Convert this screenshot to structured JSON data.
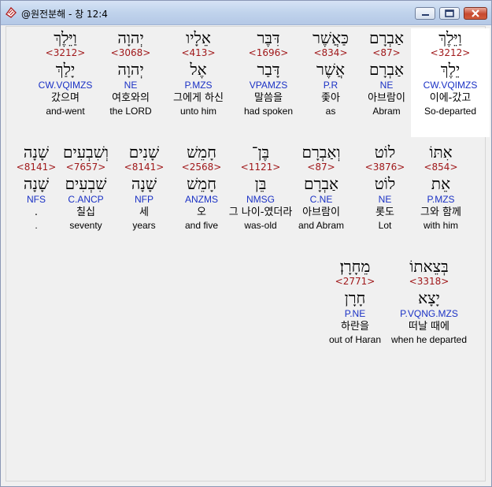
{
  "window": {
    "title": "@원전분해 - 창 12:4",
    "icon": "bible-icon",
    "controls": [
      "minimize-icon",
      "maximize-icon",
      "close-icon"
    ]
  },
  "rows": [
    {
      "words": [
        {
          "lex": "וַיֵּלֶךְ",
          "strong": "<3212>",
          "root": "יֵלֶךְ",
          "parse": "CW.VQIMZS",
          "kor": "이에-갔고",
          "eng": "So-departed",
          "highlight": true
        },
        {
          "lex": "אַבְרָם",
          "strong": "<87>",
          "root": "אַבְרָם",
          "parse": "NE",
          "kor": "아브람이",
          "eng": "Abram"
        },
        {
          "lex": "כַּאֲשֶׁר",
          "strong": "<834>",
          "root": "אֲשֶׁר",
          "parse": "P.R",
          "kor": "좇아",
          "eng": "as"
        },
        {
          "lex": "דִּבֶּר",
          "strong": "<1696>",
          "root": "דָּבַר",
          "parse": "VPAMZS",
          "kor": "말씀을",
          "eng": "had spoken"
        },
        {
          "lex": "אֵלָיו",
          "strong": "<413>",
          "root": "אֶל",
          "parse": "P.MZS",
          "kor": "그에게 하신",
          "eng": "unto him"
        },
        {
          "lex": "יְהוָה",
          "strong": "<3068>",
          "root": "יְהוָה",
          "parse": "NE",
          "kor": "여호와의",
          "eng": "the LORD"
        },
        {
          "lex": "וַיֵּלֶךְ",
          "strong": "<3212>",
          "root": "יָלַךְ",
          "parse": "CW.VQIMZS",
          "kor": "갔으며",
          "eng": "and-went"
        }
      ]
    },
    {
      "words": [
        {
          "lex": "אִתּוֹ",
          "strong": "<854>",
          "root": "אֵת",
          "parse": "P.MZS",
          "kor": "그와 함께",
          "eng": "with him"
        },
        {
          "lex": "לוֹט",
          "strong": "<3876>",
          "root": "לוֹט",
          "parse": "NE",
          "kor": "롯도",
          "eng": "Lot"
        },
        {
          "lex": "וְאַבְרָם",
          "strong": "<87>",
          "root": "אַבְרָם",
          "parse": "C.NE",
          "kor": "아브람이",
          "eng": "and Abram"
        },
        {
          "lex": "בֶּן־",
          "strong": "<1121>",
          "root": "בֵּן",
          "parse": "NMSG",
          "kor": "그 나이-였더라",
          "eng": "was-old"
        },
        {
          "lex": "חָמֵשׁ",
          "strong": "<2568>",
          "root": "חָמֵשׁ",
          "parse": "ANZMS",
          "kor": "오",
          "eng": "and five"
        },
        {
          "lex": "שָׁנִים",
          "strong": "<8141>",
          "root": "שָׁנָה",
          "parse": "NFP",
          "kor": "세",
          "eng": "years"
        },
        {
          "lex": "וְשִׁבְעִים",
          "strong": "<7657>",
          "root": "שִׁבְעִים",
          "parse": "C.ANCP",
          "kor": "칠십",
          "eng": "seventy"
        },
        {
          "lex": "שָׁנָה",
          "strong": "<8141>",
          "root": "שָׁנָה",
          "parse": "NFS",
          "kor": ".",
          "eng": "."
        }
      ]
    },
    {
      "words": [
        {
          "lex": "בְּצֵאתוֹ",
          "strong": "<3318>",
          "root": "יָצָא",
          "parse": "P.VQNG.MZS",
          "kor": "떠날 때에",
          "eng": "when he departed"
        },
        {
          "lex": "מֵחָרָן׃",
          "strong": "<2771>",
          "root": "חָרָן",
          "parse": "P.NE",
          "kor": "하란을",
          "eng": "out of Haran"
        }
      ]
    }
  ]
}
